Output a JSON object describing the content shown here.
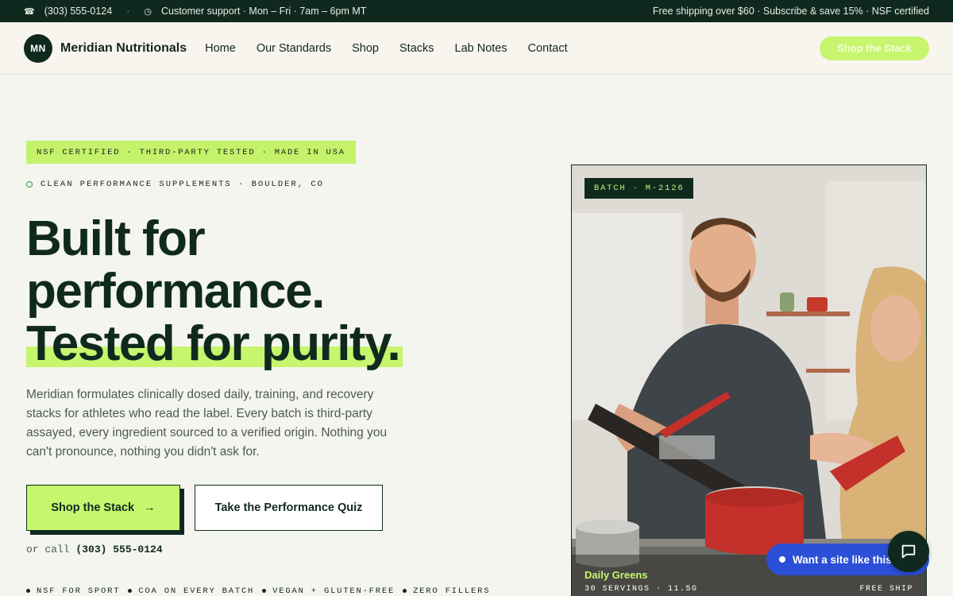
{
  "topbar": {
    "phone": "(303) 555-0124",
    "support": "Customer support · Mon – Fri · 7am – 6pm MT",
    "promo": "Free shipping over $60 · Subscribe & save 15% · NSF certified"
  },
  "nav": {
    "logo_initials": "MN",
    "brand": "Meridian Nutritionals",
    "items": [
      "Home",
      "Our Standards",
      "Shop",
      "Stacks",
      "Lab Notes",
      "Contact"
    ],
    "cta": "Shop the Stack"
  },
  "hero": {
    "cert_tag": "NSF CERTIFIED · THIRD-PARTY TESTED · MADE IN USA",
    "eyebrow": "CLEAN PERFORMANCE SUPPLEMENTS · BOULDER, CO",
    "headline_1": "Built for",
    "headline_2": "performance.",
    "headline_3": "Tested for purity.",
    "lede": "Meridian formulates clinically dosed daily, training, and recovery stacks for athletes who read the label. Every batch is third-party assayed, every ingredient sourced to a verified origin. Nothing you can't pronounce, nothing you didn't ask for.",
    "primary_cta": "Shop the Stack",
    "primary_cta_arrow": "→",
    "secondary_cta": "Take the Performance Quiz",
    "call_prefix": "or call",
    "call_number": "(303) 555-0124",
    "features": [
      "NSF FOR SPORT",
      "COA ON EVERY BATCH",
      "VEGAN + GLUTEN-FREE",
      "ZERO FILLERS"
    ]
  },
  "photo": {
    "batch": "BATCH · M-2126",
    "product_name": "Daily Greens",
    "product_meta": "30 SERVINGS · 11.5G",
    "free_ship": "FREE SHIP"
  },
  "chat": {
    "prompt": "Want a site like this?"
  },
  "colors": {
    "brand_dark": "#10291f",
    "accent_lime": "#c7f56d",
    "chat_blue": "#2b4fd6"
  }
}
